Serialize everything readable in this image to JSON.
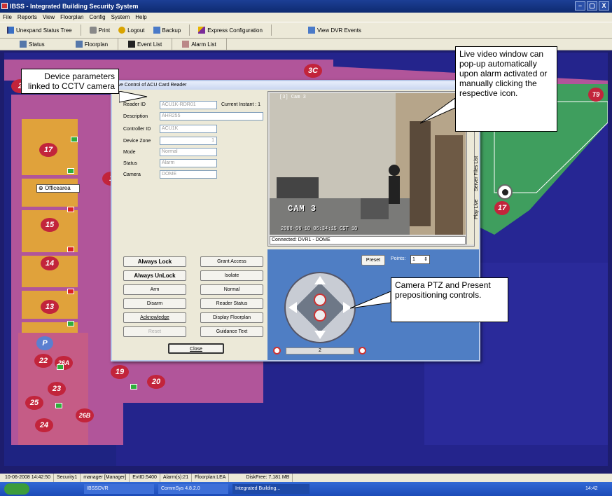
{
  "window": {
    "title": "IBSS - Integrated Building Security System",
    "min": "–",
    "max": "▢",
    "close": "X"
  },
  "menu": [
    "File",
    "Reports",
    "View",
    "Floorplan",
    "Config",
    "System",
    "Help"
  ],
  "toolbar": {
    "unexpand": "Unexpand Status Tree",
    "print": "Print",
    "logout": "Logout",
    "backup": "Backup",
    "express": "Express Configuration",
    "dvr": "View DVR Events"
  },
  "tabs": {
    "status": "Status",
    "floorplan": "Floorplan",
    "events": "Event List",
    "alarms": "Alarm List"
  },
  "floor": {
    "rooms": [
      "17",
      "15",
      "14",
      "13",
      "22",
      "26A",
      "23",
      "25",
      "26B",
      "24",
      "19",
      "20",
      "2",
      "1",
      "3C",
      "T9",
      "17",
      "P"
    ],
    "officearea": "Officearea"
  },
  "dialog": {
    "title": "Live Control of ACU Card Reader",
    "fields": {
      "reader_id_label": "Reader ID",
      "reader_id": "ACU1K-RDR01",
      "current_instant": "Current Instant : 1",
      "description_label": "Description",
      "description": "AHR255",
      "controller_label": "Controller ID",
      "controller": "ACU1K",
      "zone_label": "Device Zone",
      "zone": "1",
      "mode_label": "Mode",
      "mode": "Normal",
      "status_label": "Status",
      "status": "Alarm",
      "camera_label": "Camera",
      "camera": "DOME"
    },
    "video": {
      "cam_label": "[3] Cam 3",
      "cam_overlay": "CAM 3",
      "timestamp": "2008-06-10 06:34:15 CST 10",
      "connected": "Connected: DVR1 - DOME",
      "side_tabs": [
        "Play Live",
        "Server Files List"
      ]
    },
    "buttons": {
      "always_lock": "Always Lock",
      "always_unlock": "Always UnLock",
      "arm": "Arm",
      "disarm": "Disarm",
      "acknowledge": "Acknowledge",
      "reset": "Reset",
      "grant": "Grant Access",
      "isolate": "Isolate",
      "normal": "Normal",
      "reader_status": "Reader Status",
      "display_floorplan": "Display Floorplan",
      "guidance": "Guidance Text",
      "close": "Close"
    },
    "ptz": {
      "preset": "Preset",
      "points_label": "Points:",
      "points": "1",
      "zoom_value": "2"
    }
  },
  "annotations": {
    "device": "Device parameters linked to CCTV camera",
    "video": "Live video window can pop-up automatically upon alarm activated or manually clicking the respective icon.",
    "ptz": "Camera PTZ and Present prepositioning controls."
  },
  "statusbar": {
    "datetime": "10-06-2008 14:42:50",
    "workstation": "Security1",
    "user": "manager [Manager]",
    "evtid": "EvtID:5400",
    "alarms": "Alarm(s):21",
    "floorplan": "Floorplan:LEA",
    "disk": "DiskFree: 7,181 MB"
  },
  "taskbar": {
    "items": [
      "IBSSDVR",
      "CommSys 4.8.2.0",
      "Integrated Building..."
    ],
    "clock": "14:42"
  },
  "colors": {
    "room_pink": "#b1559a",
    "room_yellow": "#e0a23b",
    "alarm_red": "#c2243b",
    "floor_bg": "#23238a",
    "green_room": "#3f9e5e"
  }
}
